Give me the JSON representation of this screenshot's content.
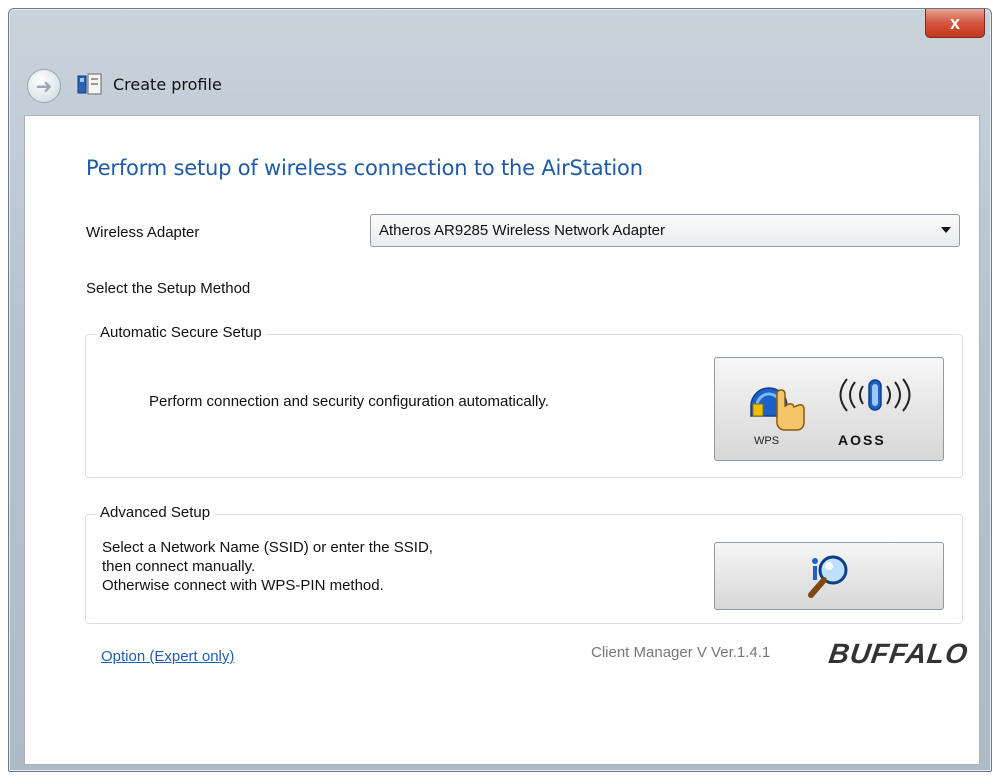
{
  "window": {
    "title": "Create profile",
    "close_label": "x"
  },
  "main": {
    "headline": "Perform setup of wireless connection to the AirStation",
    "adapter_label": "Wireless Adapter",
    "adapter_value": "Atheros AR9285 Wireless Network Adapter",
    "method_label": "Select the Setup Method"
  },
  "auto_setup": {
    "title": "Automatic Secure Setup",
    "description": "Perform connection and security configuration automatically.",
    "wps_caption": "WPS",
    "aoss_caption": "AOSS"
  },
  "advanced_setup": {
    "title": "Advanced Setup",
    "line1": "Select a Network Name (SSID) or enter the SSID,",
    "line2": "then connect manually.",
    "line3": "Otherwise connect with WPS-PIN method."
  },
  "footer": {
    "option_link": "Option (Expert only)",
    "version": "Client Manager V  Ver.1.4.1",
    "brand": "BUFFALO"
  },
  "colors": {
    "headline": "#1f5aa6",
    "link": "#1e5fb6",
    "close_red": "#c3371c"
  },
  "icons": [
    "back-arrow-icon",
    "profile-icon",
    "close-icon",
    "dropdown-arrow-icon",
    "wps-icon",
    "aoss-icon",
    "magnifier-icon"
  ]
}
